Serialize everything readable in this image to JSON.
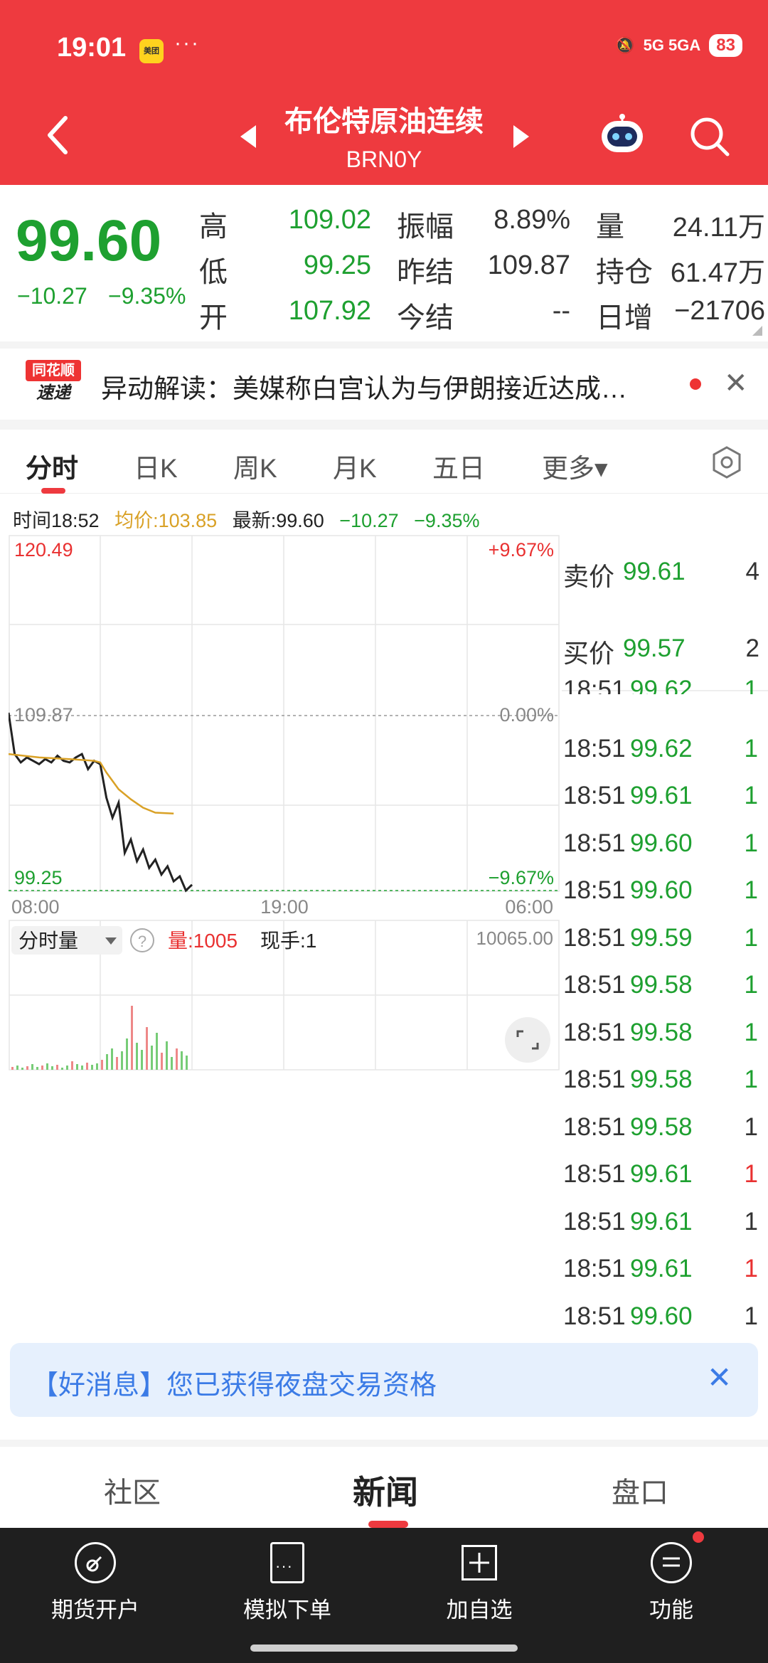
{
  "status": {
    "time": "19:01",
    "app_badge": "美团",
    "dots": "···",
    "network": "5G  5GA",
    "battery": "83"
  },
  "header": {
    "title": "布伦特原油连续",
    "code": "BRN0Y"
  },
  "quote": {
    "price": "99.60",
    "change": "−10.27",
    "change_pct": "−9.35%",
    "high_label": "高",
    "high": "109.02",
    "low_label": "低",
    "low": "99.25",
    "open_label": "开",
    "open": "107.92",
    "amp_label": "振幅",
    "amp": "8.89%",
    "prev_label": "昨结",
    "prev": "109.87",
    "today_label": "今结",
    "today": "--",
    "vol_label": "量",
    "vol": "24.11万",
    "oi_label": "持仓",
    "oi": "61.47万",
    "daily_label": "日增",
    "daily": "−21706"
  },
  "news": {
    "logo_top": "同花顺",
    "logo_bottom": "速递",
    "text": "异动解读：美媒称白宫认为与伊朗接近达成…"
  },
  "tabs": [
    "分时",
    "日K",
    "周K",
    "月K",
    "五日",
    "更多▾"
  ],
  "info": {
    "time": "时间18:52",
    "avg": "均价:103.85",
    "latest": "最新:99.60",
    "chg": "−10.27",
    "pct": "−9.35%"
  },
  "chart_data": {
    "type": "line",
    "title": "",
    "ylim": [
      99.25,
      120.49
    ],
    "ref_value": 109.87,
    "y_labels": {
      "top": "120.49",
      "mid": "109.87",
      "bottom": "99.25",
      "top_pct": "+9.67%",
      "mid_pct": "0.00%",
      "bottom_pct": "−9.67%"
    },
    "x_labels": [
      "08:00",
      "19:00",
      "06:00"
    ],
    "series": [
      {
        "name": "价格",
        "x": [
          0,
          2,
          4,
          6,
          8,
          10,
          12,
          14,
          16,
          18,
          20,
          22,
          24,
          26,
          28,
          30,
          32,
          34,
          36,
          38,
          40,
          42,
          44,
          46,
          48,
          50,
          52,
          54,
          56,
          58,
          60
        ],
        "values": [
          109.87,
          107.4,
          106.9,
          107.2,
          107.0,
          106.8,
          107.1,
          106.9,
          107.3,
          107.0,
          106.9,
          107.2,
          107.4,
          106.5,
          107.0,
          106.8,
          104.8,
          103.6,
          104.5,
          101.5,
          102.3,
          101.0,
          101.7,
          100.6,
          101.1,
          100.2,
          100.7,
          99.8,
          100.1,
          99.25,
          99.6
        ]
      },
      {
        "name": "均价",
        "x": [
          0,
          10,
          20,
          28,
          30,
          32,
          36,
          40,
          44,
          48,
          54
        ],
        "values": [
          107.4,
          107.2,
          107.1,
          107.0,
          106.9,
          106.3,
          105.3,
          104.7,
          104.2,
          103.9,
          103.85
        ]
      }
    ],
    "volume_label": "分时量",
    "volume_value": "量:1005",
    "hand_value": "现手:1",
    "volume_max": "10065.00"
  },
  "orderbook": {
    "ask_label": "卖价",
    "ask": "99.61",
    "ask_qty": "4",
    "bid_label": "买价",
    "bid": "99.57",
    "bid_qty": "2"
  },
  "trades": [
    {
      "t": "18:51",
      "p": "99.62",
      "q": "1"
    },
    {
      "t": "18:51",
      "p": "99.62",
      "q": "1"
    },
    {
      "t": "18:51",
      "p": "99.61",
      "q": "1"
    },
    {
      "t": "18:51",
      "p": "99.60",
      "q": "1"
    },
    {
      "t": "18:51",
      "p": "99.60",
      "q": "1"
    },
    {
      "t": "18:51",
      "p": "99.59",
      "q": "1"
    },
    {
      "t": "18:51",
      "p": "99.58",
      "q": "1"
    },
    {
      "t": "18:51",
      "p": "99.58",
      "q": "1"
    },
    {
      "t": "18:51",
      "p": "99.58",
      "q": "1"
    },
    {
      "t": "18:51",
      "p": "99.58",
      "q": "1"
    },
    {
      "t": "18:51",
      "p": "99.61",
      "q": "1"
    },
    {
      "t": "18:51",
      "p": "99.61",
      "q": "1"
    },
    {
      "t": "18:51",
      "p": "99.61",
      "q": "1"
    },
    {
      "t": "18:51",
      "p": "99.60",
      "q": "1"
    }
  ],
  "banner": {
    "text": "【好消息】您已获得夜盘交易资格"
  },
  "subtabs": [
    "社区",
    "新闻",
    "盘口"
  ],
  "bottom": [
    "期货开户",
    "模拟下单",
    "加自选",
    "功能"
  ],
  "colors": {
    "red": "#ee3a3f",
    "green": "#1ea030",
    "gold": "#d9a126"
  }
}
